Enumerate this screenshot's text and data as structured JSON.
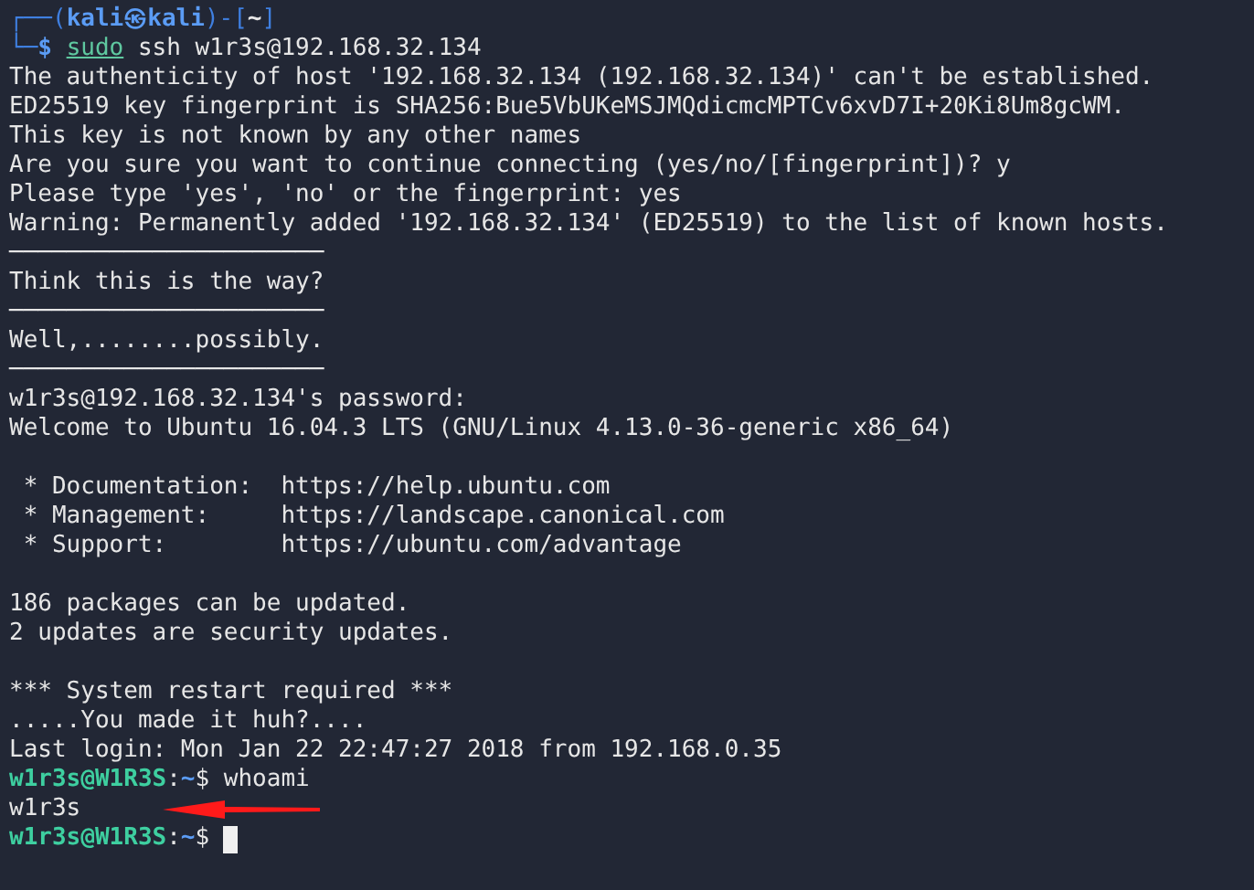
{
  "terminal": {
    "lines": [
      {
        "kind": "text",
        "segments": [
          {
            "text": "┌──(",
            "kind": "frame"
          },
          {
            "text": "kali㉿kali",
            "kind": "host"
          },
          {
            "text": ")-[",
            "kind": "frame"
          },
          {
            "text": "~",
            "kind": "dir"
          },
          {
            "text": "]",
            "kind": "frame"
          }
        ]
      },
      {
        "kind": "text",
        "segments": [
          {
            "text": "└─",
            "kind": "frame"
          },
          {
            "text": "$ ",
            "kind": "host"
          },
          {
            "text": "sudo",
            "kind": "keyword"
          },
          {
            "text": " ssh w1r3s@192.168.32.134",
            "kind": "text"
          }
        ]
      },
      {
        "kind": "text",
        "segments": [
          {
            "text": "The authenticity of host '192.168.32.134 (192.168.32.134)' can't be established.",
            "kind": "text"
          }
        ]
      },
      {
        "kind": "text",
        "segments": [
          {
            "text": "ED25519 key fingerprint is SHA256:Bue5VbUKeMSJMQdicmcMPTCv6xvD7I+20Ki8Um8gcWM.",
            "kind": "text"
          }
        ]
      },
      {
        "kind": "text",
        "segments": [
          {
            "text": "This key is not known by any other names",
            "kind": "text"
          }
        ]
      },
      {
        "kind": "text",
        "segments": [
          {
            "text": "Are you sure you want to continue connecting (yes/no/[fingerprint])? y",
            "kind": "text"
          }
        ]
      },
      {
        "kind": "text",
        "segments": [
          {
            "text": "Please type 'yes', 'no' or the fingerprint: yes",
            "kind": "text"
          }
        ]
      },
      {
        "kind": "text",
        "segments": [
          {
            "text": "Warning: Permanently added '192.168.32.134' (ED25519) to the list of known hosts.",
            "kind": "text"
          }
        ]
      },
      {
        "kind": "text",
        "segments": [
          {
            "text": "──────────────────────",
            "kind": "text"
          }
        ]
      },
      {
        "kind": "text",
        "segments": [
          {
            "text": "Think this is the way?",
            "kind": "text"
          }
        ]
      },
      {
        "kind": "text",
        "segments": [
          {
            "text": "──────────────────────",
            "kind": "text"
          }
        ]
      },
      {
        "kind": "text",
        "segments": [
          {
            "text": "Well,........possibly.",
            "kind": "text"
          }
        ]
      },
      {
        "kind": "text",
        "segments": [
          {
            "text": "──────────────────────",
            "kind": "text"
          }
        ]
      },
      {
        "kind": "text",
        "segments": [
          {
            "text": "w1r3s@192.168.32.134's password:",
            "kind": "text"
          }
        ]
      },
      {
        "kind": "text",
        "segments": [
          {
            "text": "Welcome to Ubuntu 16.04.3 LTS (GNU/Linux 4.13.0-36-generic x86_64)",
            "kind": "text"
          }
        ]
      },
      {
        "kind": "blank"
      },
      {
        "kind": "text",
        "segments": [
          {
            "text": " * Documentation:  https://help.ubuntu.com",
            "kind": "text"
          }
        ]
      },
      {
        "kind": "text",
        "segments": [
          {
            "text": " * Management:     https://landscape.canonical.com",
            "kind": "text"
          }
        ]
      },
      {
        "kind": "text",
        "segments": [
          {
            "text": " * Support:        https://ubuntu.com/advantage",
            "kind": "text"
          }
        ]
      },
      {
        "kind": "blank"
      },
      {
        "kind": "text",
        "segments": [
          {
            "text": "186 packages can be updated.",
            "kind": "text"
          }
        ]
      },
      {
        "kind": "text",
        "segments": [
          {
            "text": "2 updates are security updates.",
            "kind": "text"
          }
        ]
      },
      {
        "kind": "blank"
      },
      {
        "kind": "text",
        "segments": [
          {
            "text": "*** System restart required ***",
            "kind": "text"
          }
        ]
      },
      {
        "kind": "text",
        "segments": [
          {
            "text": ".....You made it huh?....",
            "kind": "text"
          }
        ]
      },
      {
        "kind": "text",
        "segments": [
          {
            "text": "Last login: Mon Jan 22 22:47:27 2018 from 192.168.0.35",
            "kind": "text"
          }
        ]
      },
      {
        "kind": "text",
        "segments": [
          {
            "text": "w1r3s@W1R3S",
            "kind": "user"
          },
          {
            "text": ":",
            "kind": "text"
          },
          {
            "text": "~",
            "kind": "path"
          },
          {
            "text": "$ whoami",
            "kind": "text"
          }
        ]
      },
      {
        "kind": "text",
        "segments": [
          {
            "text": "w1r3s",
            "kind": "text"
          },
          {
            "kind": "arrow"
          }
        ]
      },
      {
        "kind": "text",
        "segments": [
          {
            "text": "w1r3s@W1R3S",
            "kind": "user"
          },
          {
            "text": ":",
            "kind": "text"
          },
          {
            "text": "~",
            "kind": "path"
          },
          {
            "text": "$ ",
            "kind": "text"
          },
          {
            "kind": "cursor"
          }
        ]
      }
    ]
  }
}
